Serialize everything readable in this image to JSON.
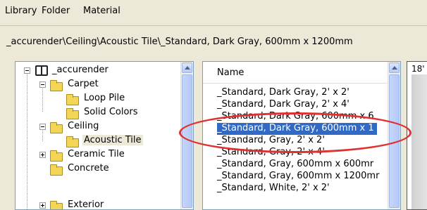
{
  "menu": {
    "library": "Library",
    "folder": "Folder",
    "material": "Material"
  },
  "path": "_accurender\\Ceiling\\Acoustic Tile\\_Standard, Dark Gray, 600mm x 1200mm",
  "tree": {
    "items": [
      {
        "label": "_accurender"
      },
      {
        "label": "Carpet"
      },
      {
        "label": "Loop Pile"
      },
      {
        "label": "Solid Colors"
      },
      {
        "label": "Ceiling"
      },
      {
        "label": "Acoustic Tile"
      },
      {
        "label": "Ceramic Tile"
      },
      {
        "label": "Concrete"
      },
      {
        "label": "Exterior"
      }
    ]
  },
  "list": {
    "header": "Name",
    "rows": [
      "_Standard, Dark Gray,  2' x 2'",
      "_Standard, Dark Gray,  2' x 4'",
      "_Standard, Dark Gray,  600mm x 6",
      "_Standard, Dark Gray, 600mm x 1",
      "_Standard, Gray,  2' x 2'",
      "_Standard, Gray,  2' x 4'",
      "_Standard, Gray,  600mm x 600mr",
      "_Standard, Gray, 600mm x 1200mr",
      "_Standard, White,  2' x 2'"
    ],
    "selected_index": 3
  },
  "preview": {
    "label": "18'"
  },
  "colors": {
    "selection": "#316ac5",
    "highlight_ellipse": "#e03030"
  }
}
